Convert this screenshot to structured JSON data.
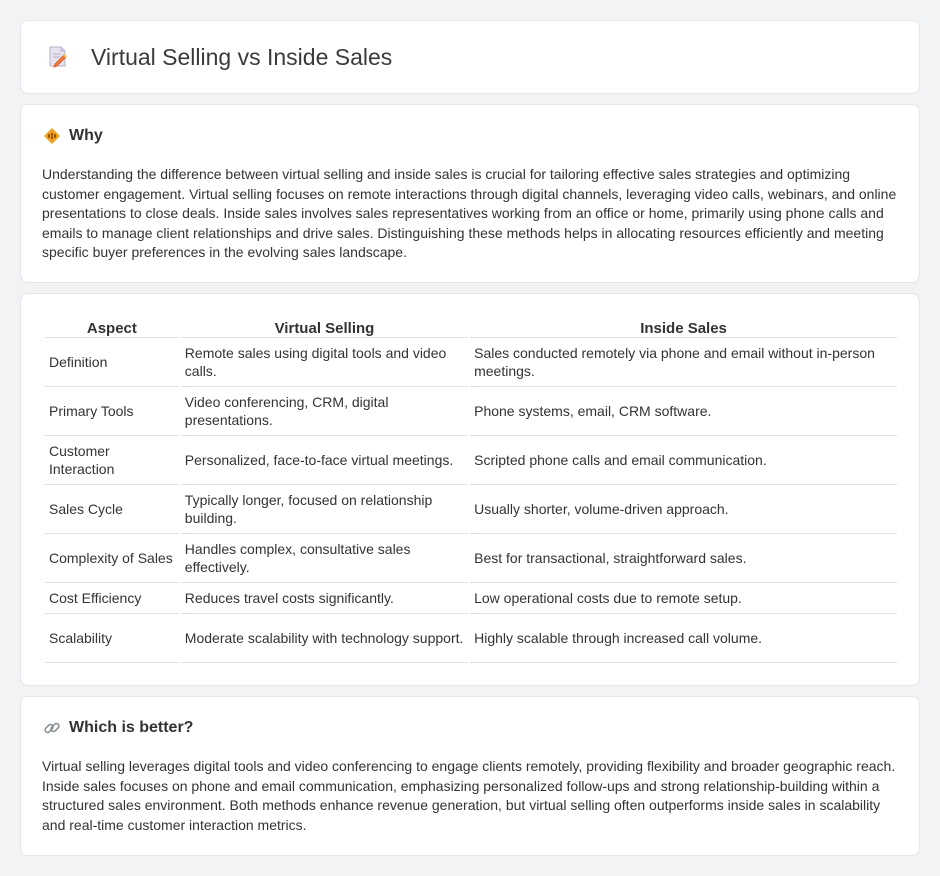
{
  "page": {
    "title": "Virtual Selling vs Inside Sales"
  },
  "why": {
    "title": "Why",
    "icon": "diamond-warning-icon",
    "body": "Understanding the difference between virtual selling and inside sales is crucial for tailoring effective sales strategies and optimizing customer engagement. Virtual selling focuses on remote interactions through digital channels, leveraging video calls, webinars, and online presentations to close deals. Inside sales involves sales representatives working from an office or home, primarily using phone calls and emails to manage client relationships and drive sales. Distinguishing these methods helps in allocating resources efficiently and meeting specific buyer preferences in the evolving sales landscape."
  },
  "table": {
    "headers": [
      "Aspect",
      "Virtual Selling",
      "Inside Sales"
    ],
    "rows": [
      [
        "Definition",
        "Remote sales using digital tools and video calls.",
        "Sales conducted remotely via phone and email without in-person meetings."
      ],
      [
        "Primary Tools",
        "Video conferencing, CRM, digital presentations.",
        "Phone systems, email, CRM software."
      ],
      [
        "Customer Interaction",
        "Personalized, face-to-face virtual meetings.",
        "Scripted phone calls and email communication."
      ],
      [
        "Sales Cycle",
        "Typically longer, focused on relationship building.",
        "Usually shorter, volume-driven approach."
      ],
      [
        "Complexity of Sales",
        "Handles complex, consultative sales effectively.",
        "Best for transactional, straightforward sales."
      ],
      [
        "Cost Efficiency",
        "Reduces travel costs significantly.",
        "Low operational costs due to remote setup."
      ],
      [
        "Scalability",
        "Moderate scalability with technology support.",
        "Highly scalable through increased call volume."
      ]
    ]
  },
  "better": {
    "title": "Which is better?",
    "icon": "link-icon",
    "body": "Virtual selling leverages digital tools and video conferencing to engage clients remotely, providing flexibility and broader geographic reach. Inside sales focuses on phone and email communication, emphasizing personalized follow-ups and strong relationship-building within a structured sales environment. Both methods enhance revenue generation, but virtual selling often outperforms inside sales in scalability and real-time customer interaction metrics."
  },
  "colors": {
    "background": "#f1f3f5",
    "card": "#ffffff",
    "border": "#e2e5e9",
    "accent_orange": "#f0a020"
  }
}
